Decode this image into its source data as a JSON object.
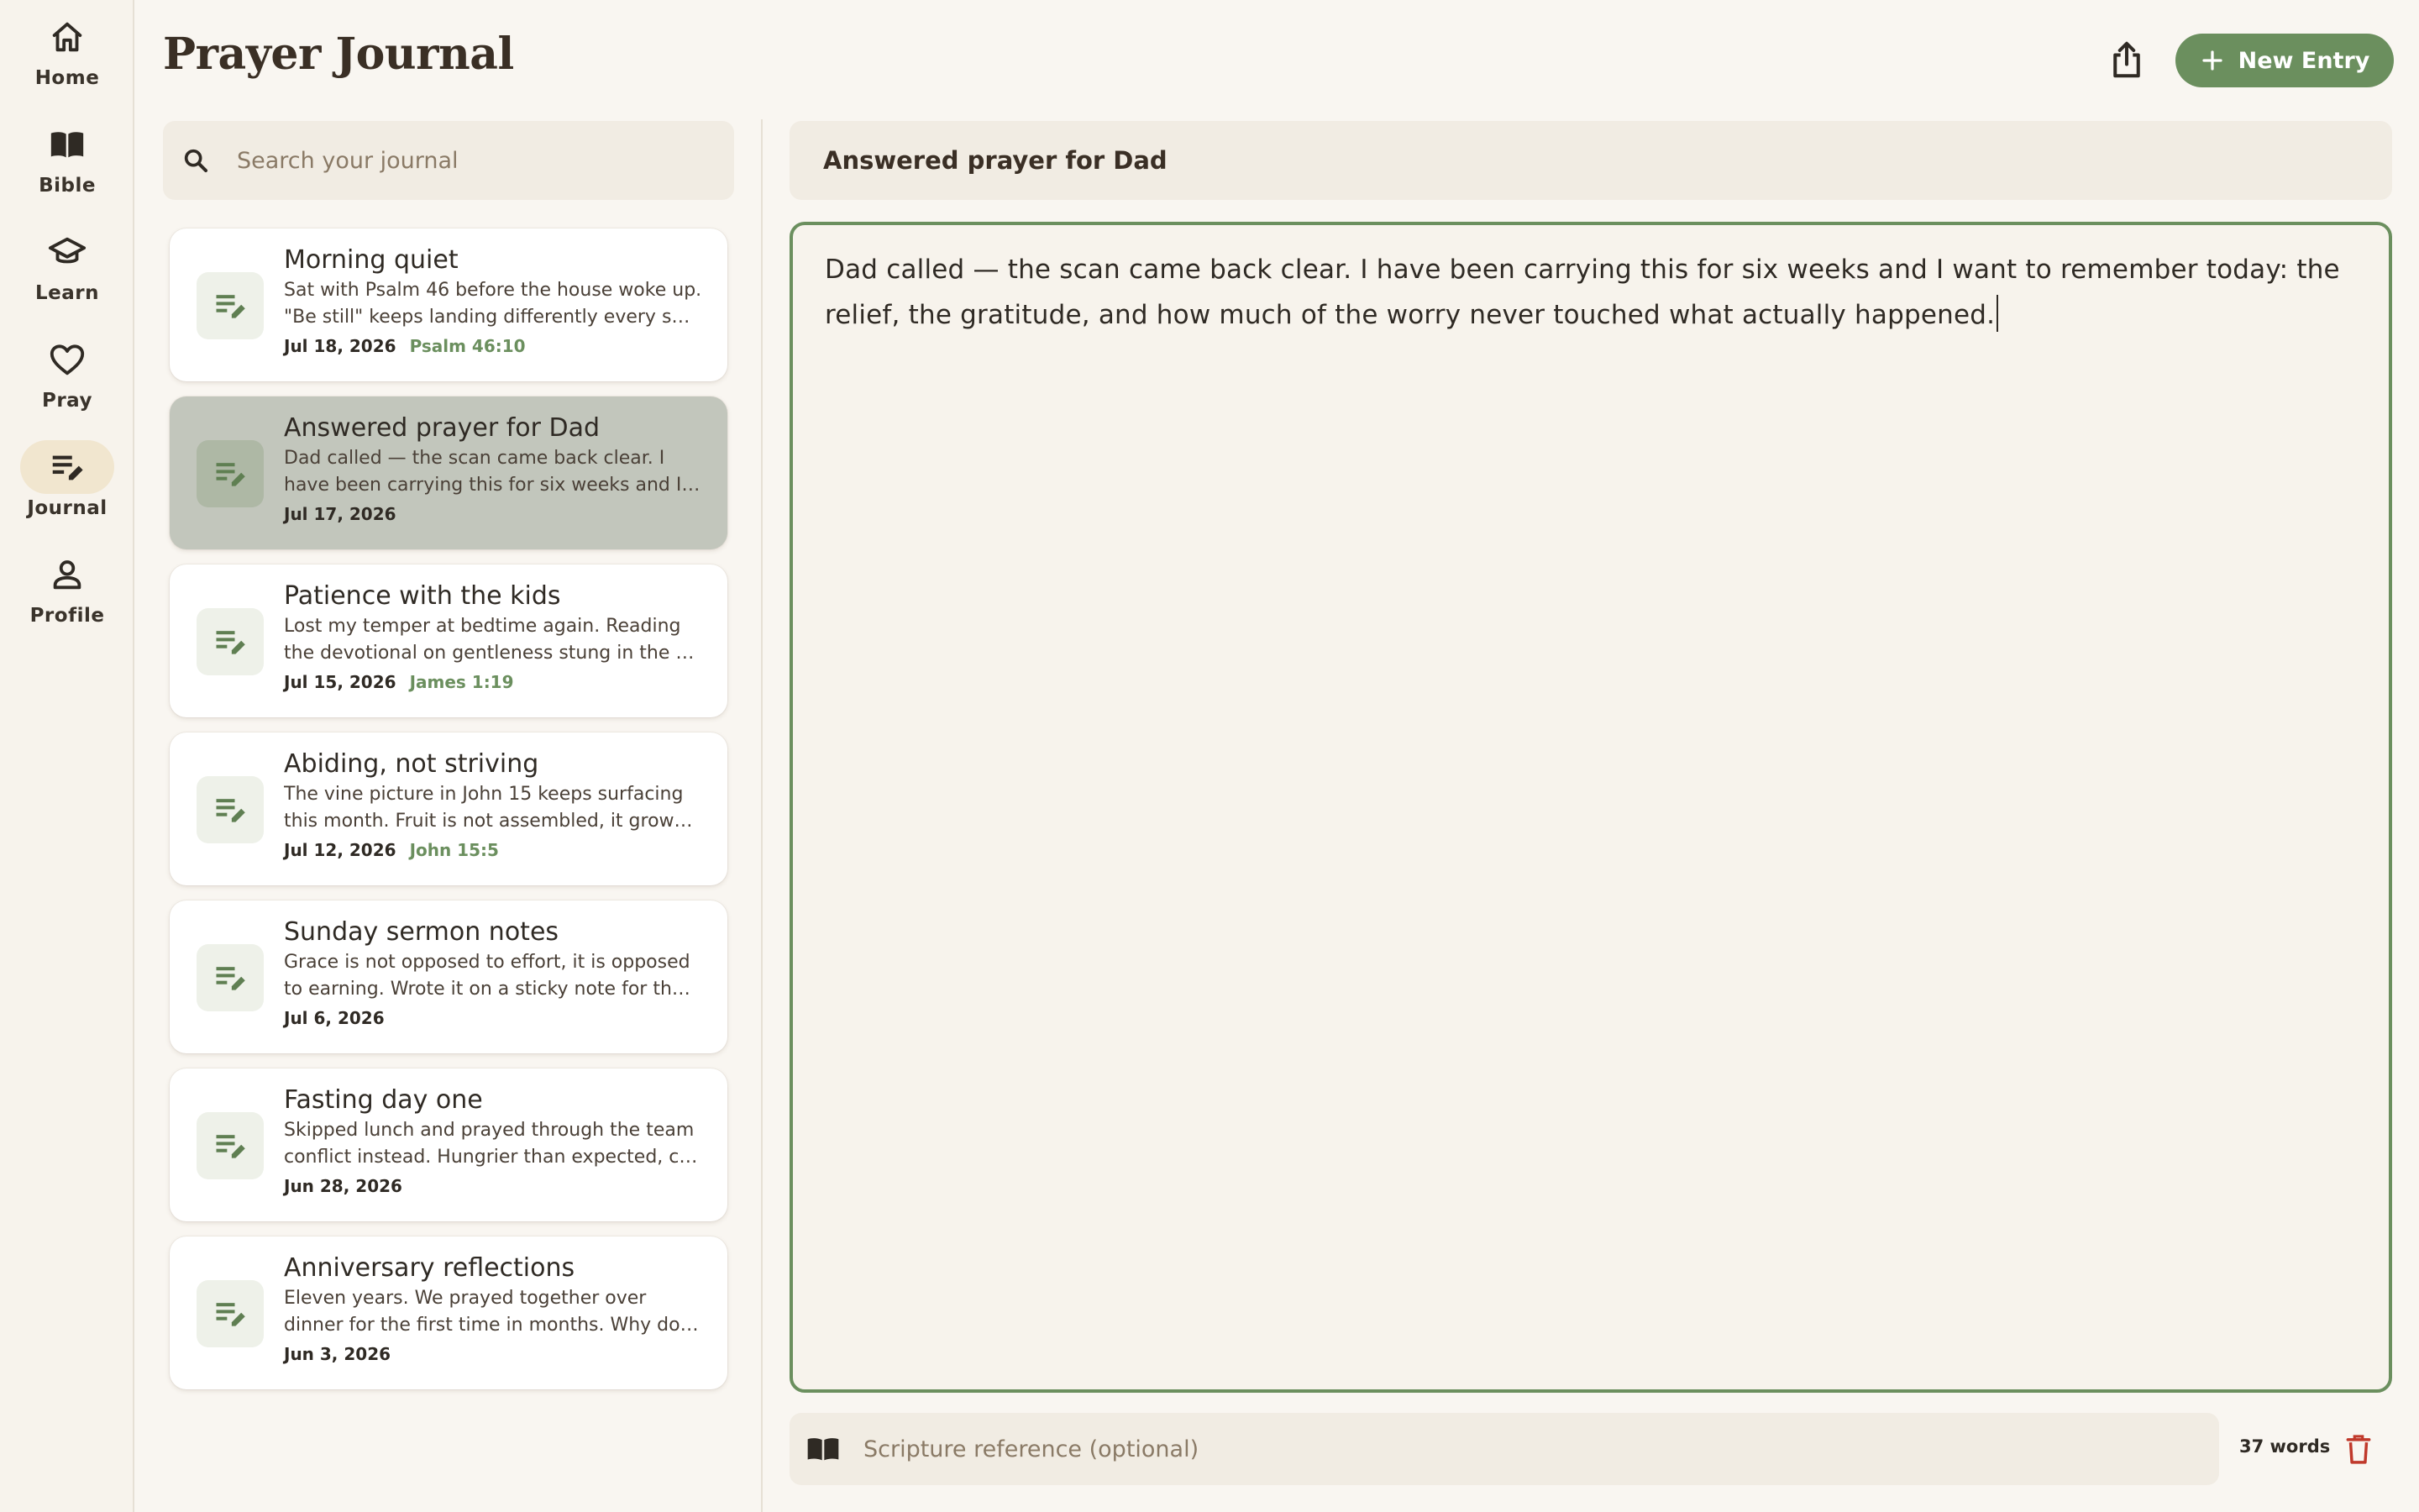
{
  "app": {
    "title": "Prayer Journal"
  },
  "colors": {
    "accent": "#6b8f5e",
    "danger": "#c0392b",
    "active_nav": "#f1e6cf"
  },
  "nav": {
    "items": [
      {
        "label": "Home",
        "icon": "home-icon"
      },
      {
        "label": "Bible",
        "icon": "book-icon"
      },
      {
        "label": "Learn",
        "icon": "graduation-cap-icon"
      },
      {
        "label": "Pray",
        "icon": "heart-icon"
      },
      {
        "label": "Journal",
        "icon": "journal-edit-icon",
        "active": true
      },
      {
        "label": "Profile",
        "icon": "person-icon"
      }
    ]
  },
  "header": {
    "new_entry_label": "New Entry",
    "share_icon": "share-icon",
    "plus_icon": "plus-icon"
  },
  "search": {
    "placeholder": "Search your journal",
    "value": ""
  },
  "entries": [
    {
      "title": "Morning quiet",
      "preview": "Sat with Psalm 46 before the house woke up. \"Be still\" keeps landing differently every s…",
      "date": "Jul 18, 2026",
      "scripture": "Psalm 46:10"
    },
    {
      "title": "Answered prayer for Dad",
      "preview": "Dad called — the scan came back clear. I have been carrying this for six weeks and I…",
      "date": "Jul 17, 2026",
      "scripture": "",
      "active": true
    },
    {
      "title": "Patience with the kids",
      "preview": "Lost my temper at bedtime again. Reading the devotional on gentleness stung in the …",
      "date": "Jul 15, 2026",
      "scripture": "James 1:19"
    },
    {
      "title": "Abiding, not striving",
      "preview": "The vine picture in John 15 keeps surfacing this month. Fruit is not assembled, it grow…",
      "date": "Jul 12, 2026",
      "scripture": "John 15:5"
    },
    {
      "title": "Sunday sermon notes",
      "preview": "Grace is not opposed to effort, it is opposed to earning. Wrote it on a sticky note for th…",
      "date": "Jul 6, 2026",
      "scripture": ""
    },
    {
      "title": "Fasting day one",
      "preview": "Skipped lunch and prayed through the team conflict instead. Hungrier than expected, c…",
      "date": "Jun 28, 2026",
      "scripture": ""
    },
    {
      "title": "Anniversary reflections",
      "preview": "Eleven years. We prayed together over dinner for the first time in months. Why do…",
      "date": "Jun 3, 2026",
      "scripture": ""
    }
  ],
  "editor": {
    "title": "Answered prayer for Dad",
    "body": "Dad called — the scan came back clear. I have been carrying this for six weeks and I want to remember today: the relief, the gratitude, and how much of the worry never touched what actually happened.",
    "scripture_placeholder": "Scripture reference (optional)",
    "scripture_value": "",
    "word_count": "37 words",
    "delete_icon": "trash-icon"
  }
}
